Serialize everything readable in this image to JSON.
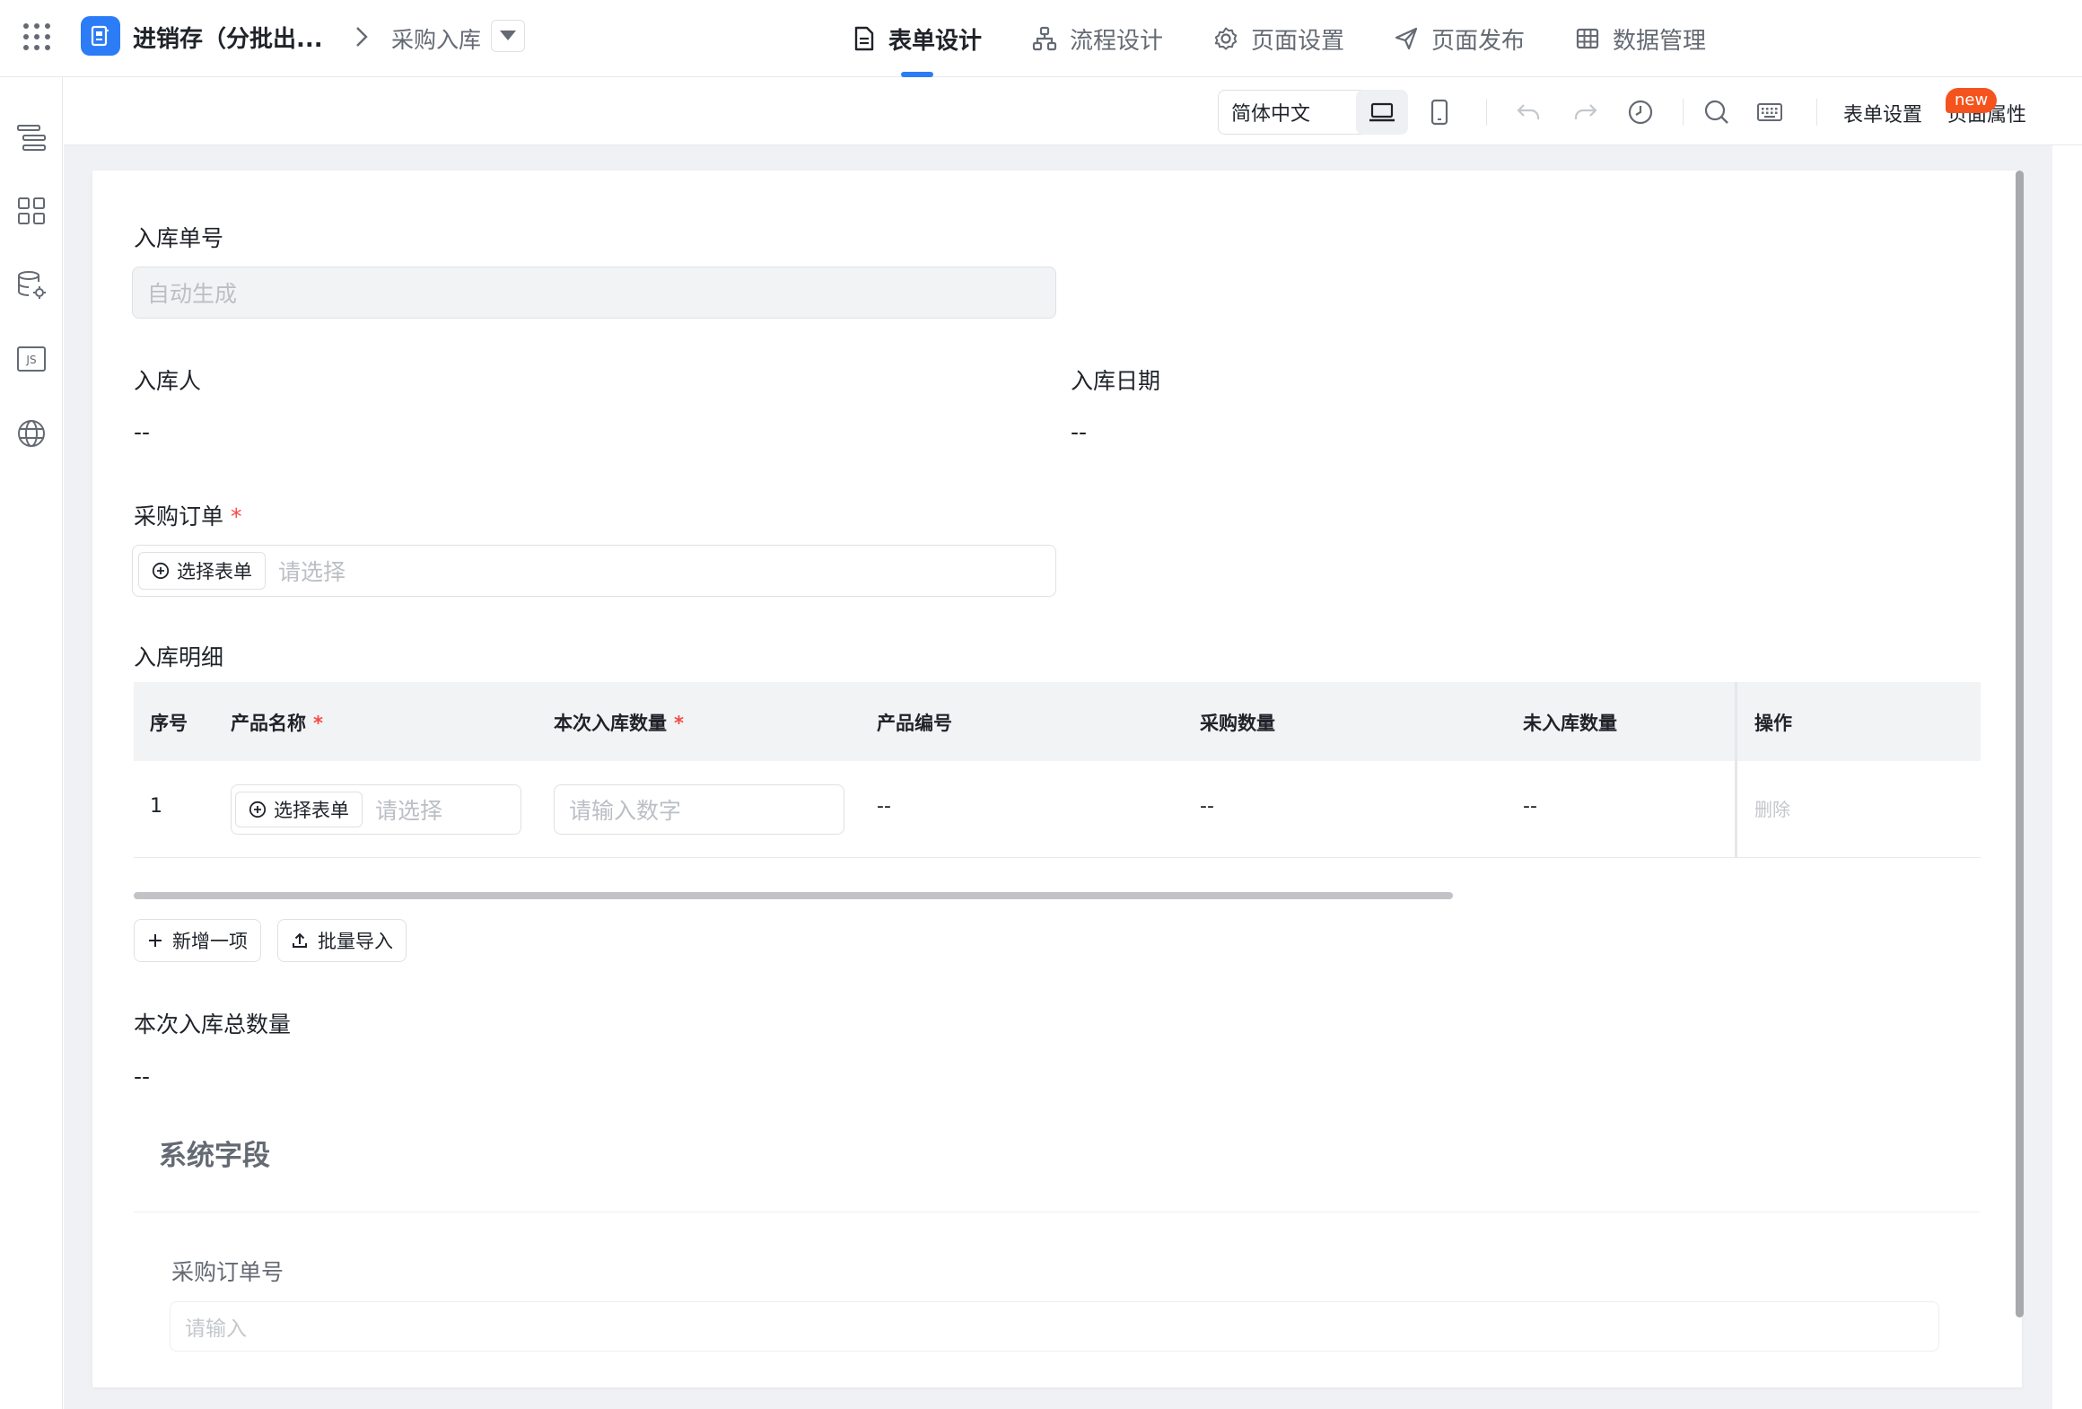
{
  "header": {
    "app_name": "进销存（分批出...",
    "page_name": "采购入库",
    "nav": [
      {
        "label": "表单设计",
        "active": true,
        "icon": "document-icon"
      },
      {
        "label": "流程设计",
        "active": false,
        "icon": "flow-icon"
      },
      {
        "label": "页面设置",
        "active": false,
        "icon": "gear-icon"
      },
      {
        "label": "页面发布",
        "active": false,
        "icon": "send-icon"
      },
      {
        "label": "数据管理",
        "active": false,
        "icon": "table-icon"
      }
    ],
    "accent_color": "#2b7cf6"
  },
  "left_rail": [
    "outline-icon",
    "components-icon",
    "datasource-icon",
    "js-icon",
    "globe-icon"
  ],
  "toolbar": {
    "language": "简体中文",
    "form_settings": "表单设置",
    "page_properties": "页面属性",
    "new_badge": "new"
  },
  "form": {
    "inbound_no": {
      "label": "入库单号",
      "placeholder": "自动生成"
    },
    "inbound_person": {
      "label": "入库人",
      "value": "--"
    },
    "inbound_date": {
      "label": "入库日期",
      "value": "--"
    },
    "purchase_order": {
      "label": "采购订单",
      "required_mark": "*",
      "button": "选择表单",
      "placeholder": "请选择"
    },
    "detail": {
      "label": "入库明细",
      "columns": [
        {
          "label": "序号"
        },
        {
          "label": "产品名称",
          "required_mark": "*"
        },
        {
          "label": "本次入库数量",
          "required_mark": "*"
        },
        {
          "label": "产品编号"
        },
        {
          "label": "采购数量"
        },
        {
          "label": "未入库数量"
        },
        {
          "label": "操作"
        }
      ],
      "rows": [
        {
          "index": "1",
          "product_button": "选择表单",
          "product_placeholder": "请选择",
          "qty_placeholder": "请输入数字",
          "code": "--",
          "purchase_qty": "--",
          "pending_qty": "--",
          "action": "删除"
        }
      ],
      "add_button": "新增一项",
      "import_button": "批量导入"
    },
    "total": {
      "label": "本次入库总数量",
      "value": "--"
    },
    "system": {
      "title": "系统字段",
      "po_no": {
        "label": "采购订单号",
        "placeholder": "请输入"
      }
    }
  }
}
